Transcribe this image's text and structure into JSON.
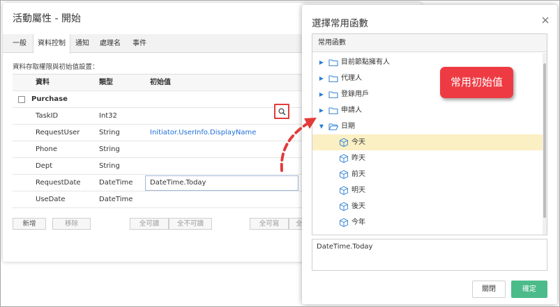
{
  "back_dialog": {
    "title": "活動屬性 - 開始",
    "tabs": [
      "一般",
      "資料控制",
      "通知",
      "處理名",
      "事件"
    ],
    "active_tab": "資料控制",
    "section_caption": "資料存取權限與初始值設置：",
    "grid": {
      "columns": [
        "資料",
        "類型",
        "初始值"
      ],
      "group": "Purchase",
      "rows": [
        {
          "name": "TaskID",
          "type": "Int32",
          "init": ""
        },
        {
          "name": "RequestUser",
          "type": "String",
          "init": "Initiator.UserInfo.DisplayName"
        },
        {
          "name": "Phone",
          "type": "String",
          "init": ""
        },
        {
          "name": "Dept",
          "type": "String",
          "init": ""
        },
        {
          "name": "RequestDate",
          "type": "DateTime",
          "init": "DateTime.Today"
        },
        {
          "name": "UseDate",
          "type": "DateTime",
          "init": ""
        }
      ]
    },
    "buttons": {
      "add": "新增",
      "remove": "移除",
      "all_readable": "全可讀",
      "none_readable": "全不可讀",
      "all_writable": "全可寫",
      "all_writable_cut": "全"
    }
  },
  "front_dialog": {
    "title": "選擇常用函數",
    "tree_header": "常用函數",
    "tree": [
      {
        "label": "目前節點擁有人",
        "kind": "folder",
        "expanded": false
      },
      {
        "label": "代理人",
        "kind": "folder",
        "expanded": false
      },
      {
        "label": "登錄用戶",
        "kind": "folder",
        "expanded": false
      },
      {
        "label": "申請人",
        "kind": "folder",
        "expanded": false
      },
      {
        "label": "日期",
        "kind": "folder",
        "expanded": true
      },
      {
        "label": "今天",
        "kind": "item",
        "selected": true
      },
      {
        "label": "昨天",
        "kind": "item"
      },
      {
        "label": "前天",
        "kind": "item"
      },
      {
        "label": "明天",
        "kind": "item"
      },
      {
        "label": "後天",
        "kind": "item"
      },
      {
        "label": "今年",
        "kind": "item"
      }
    ],
    "result": "DateTime.Today",
    "close_label": "關閉",
    "ok_label": "確定"
  },
  "annotation": {
    "callout": "常用初始值"
  },
  "colors": {
    "accent_green": "#4cbb8a",
    "callout_red": "#ee3b43",
    "link_blue": "#1e6fd9",
    "selected_row": "#fbefc4"
  }
}
